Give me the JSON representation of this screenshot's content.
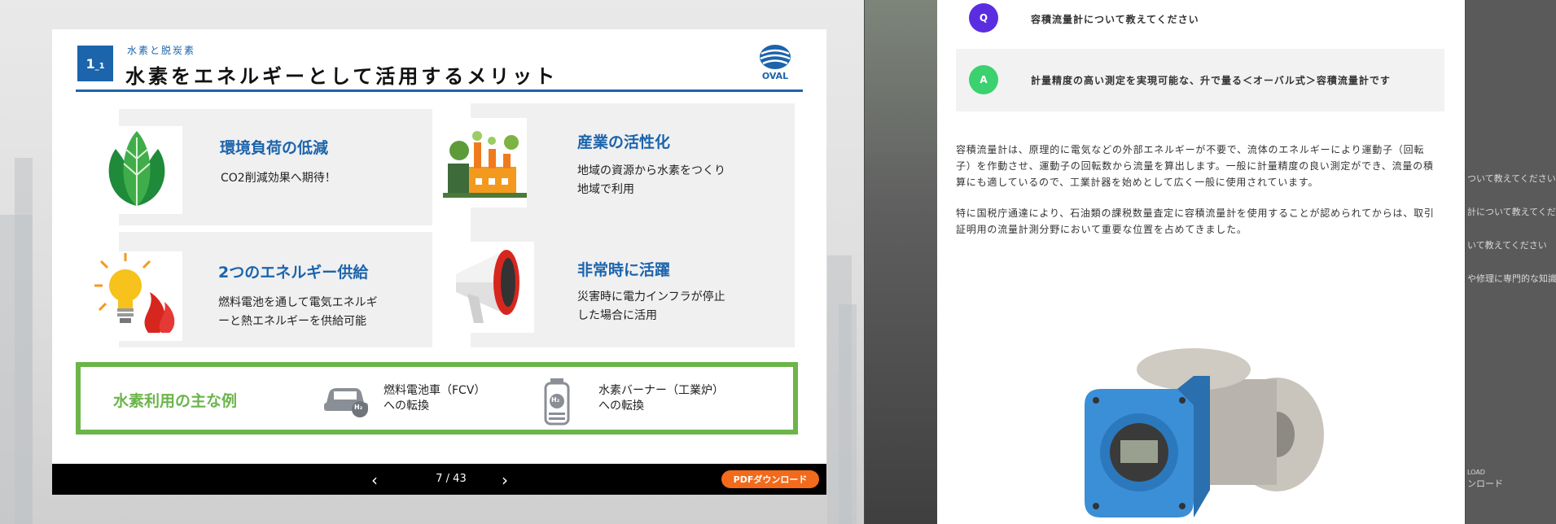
{
  "slide": {
    "section_number": "1",
    "section_sub_number": "_1",
    "section_category": "水素と脱炭素",
    "title": "水素をエネルギーとして活用するメリット",
    "logo_text": "OVAL",
    "cards": [
      {
        "title": "環境負荷の低減",
        "text": "CO2削減効果へ期待！",
        "icon": "leaf-icon"
      },
      {
        "title": "産業の活性化",
        "text": "地域の資源から水素をつくり\n地域で利用",
        "icon": "factory-icon"
      },
      {
        "title": "2つのエネルギー供給",
        "text": "燃料電池を通して電気エネルギ\nーと熱エネルギーを供給可能",
        "icon": "bulb-flame-icon"
      },
      {
        "title": "非常時に活躍",
        "text": "災害時に電力インフラが停止\nした場合に活用",
        "icon": "megaphone-icon"
      }
    ],
    "examples": {
      "title": "水素利用の主な例",
      "items": [
        {
          "text": "燃料電池車（FCV）\nへの転換",
          "icon": "fcv-car-icon",
          "badge": "H₂"
        },
        {
          "text": "水素バーナー（工業炉）\nへの転換",
          "icon": "hydrogen-burner-icon",
          "badge": "H₂"
        }
      ]
    },
    "pager": {
      "prev": "‹",
      "count": "7 / 43",
      "next": "›",
      "pdf_button": "PDFダウンロード"
    }
  },
  "qa": {
    "q_badge": "Q",
    "question": "容積流量計について教えてください",
    "a_badge": "A",
    "answer": "計量精度の高い測定を実現可能な、升で量る＜オーバル式＞容積流量計です",
    "paragraph1": "容積流量計は、原理的に電気などの外部エネルギーが不要で、流体のエネルギーにより運動子（回転子）を作動させ、運動子の回転数から流量を算出します。一般に計量精度の良い測定ができ、流量の積算にも適しているので、工業計器を始めとして広く一般に使用されています。",
    "paragraph2": "特に国税庁通達により、石油類の課税数量査定に容積流量計を使用することが認められてからは、取引証明用の流量計測分野において重要な位置を占めてきました。"
  },
  "background_panel": {
    "items": [
      "ついて教えてください",
      "計について教えてくださ",
      "いて教えてください",
      "や修理に専門的な知識"
    ],
    "download_label_top": "LOAD",
    "download_label": "ンロード"
  },
  "colors": {
    "brand_blue": "#1c64ac",
    "green": "#6bb54a",
    "orange": "#f26a1b",
    "q_purple": "#5b2de0",
    "a_green": "#3bd16f"
  }
}
